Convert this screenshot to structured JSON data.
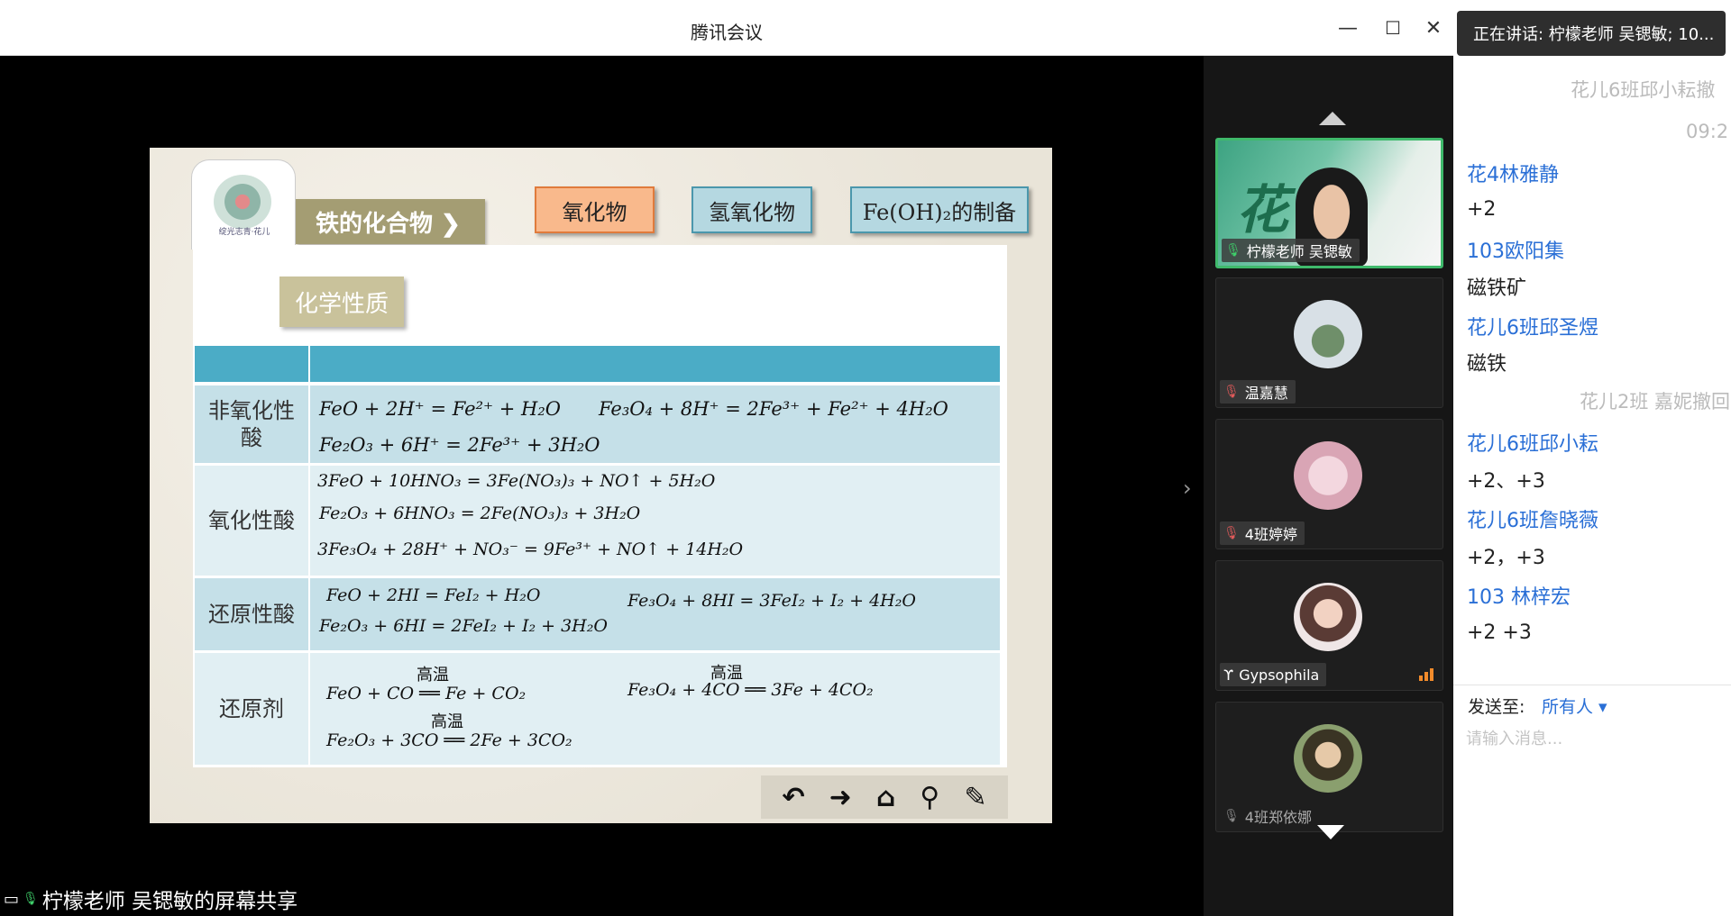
{
  "window": {
    "title": "腾讯会议",
    "controls": {
      "minimize": "—",
      "maximize": "☐",
      "close": "✕"
    }
  },
  "slide": {
    "logo_caption": "绽光志青·花儿",
    "nav_main": "铁的化合物 ❯",
    "nav_buttons": [
      "氧化物",
      "氢氧化物",
      "Fe(OH)₂的制备"
    ],
    "section_label": "化学性质",
    "table": {
      "rows": [
        {
          "label": "非氧化性酸",
          "equations": [
            "FeO + 2H⁺ = Fe²⁺ + H₂O",
            "Fe₃O₄ + 8H⁺ = 2Fe³⁺ + Fe²⁺ + 4H₂O",
            "Fe₂O₃ + 6H⁺ = 2Fe³⁺ + 3H₂O"
          ]
        },
        {
          "label": "氧化性酸",
          "equations": [
            "3FeO + 10HNO₃ = 3Fe(NO₃)₃ + NO↑ + 5H₂O",
            "Fe₂O₃ + 6HNO₃ = 2Fe(NO₃)₃ + 3H₂O",
            "3Fe₃O₄ + 28H⁺ + NO₃⁻ = 9Fe³⁺ + NO↑ + 14H₂O"
          ]
        },
        {
          "label": "还原性酸",
          "equations": [
            "FeO + 2HI = FeI₂ + H₂O",
            "Fe₃O₄ + 8HI = 3FeI₂ + I₂ + 4H₂O",
            "Fe₂O₃ + 6HI = 2FeI₂ + I₂ + 3H₂O"
          ]
        },
        {
          "label": "还原剂",
          "condition": "高温",
          "equations": [
            "FeO + CO ══ Fe + CO₂",
            "Fe₃O₄ + 4CO ══ 3Fe + 4CO₂",
            "Fe₂O₃ + 3CO ══ 2Fe + 3CO₂"
          ]
        }
      ]
    },
    "tools": [
      "↶",
      "➜",
      "⌂",
      "⚲",
      "✎"
    ]
  },
  "share_label": "柠檬老师 吴锶敏的屏幕共享",
  "participants": [
    {
      "name": "柠檬老师 吴锶敏",
      "mic": "on",
      "active": true
    },
    {
      "name": "温嘉慧",
      "mic": "off"
    },
    {
      "name": "4班婷婷",
      "mic": "off"
    },
    {
      "name": "Gypsophila",
      "mic": "off",
      "prefix": "ϒ"
    },
    {
      "name": "4班郑依娜",
      "mic": "off"
    }
  ],
  "chat": {
    "speaking": "正在讲话: 柠檬老师 吴锶敏; 10...",
    "messages": [
      {
        "type": "system",
        "text": "花儿6班邱小耘撤"
      },
      {
        "type": "system",
        "text": "09:2"
      },
      {
        "type": "msg",
        "name": "花4林雅静",
        "text": "+2"
      },
      {
        "type": "msg",
        "name": "103欧阳集",
        "text": "磁铁矿"
      },
      {
        "type": "msg",
        "name": "花儿6班邱圣煜",
        "text": "磁铁"
      },
      {
        "type": "system",
        "text": "花儿2班 嘉妮撤回"
      },
      {
        "type": "msg",
        "name": "花儿6班邱小耘",
        "text": "+2、+3"
      },
      {
        "type": "msg",
        "name": "花儿6班詹晓薇",
        "text": "+2，+3"
      },
      {
        "type": "msg",
        "name": "103 林梓宏",
        "text": "+2 +3"
      }
    ],
    "send_to_label": "发送至:",
    "send_to_value": "所有人 ▾",
    "input_placeholder": "请输入消息..."
  },
  "colors": {
    "accent_green": "#3fb96b",
    "chat_name_blue": "#2a6fd6",
    "table_header": "#4bacc6"
  }
}
